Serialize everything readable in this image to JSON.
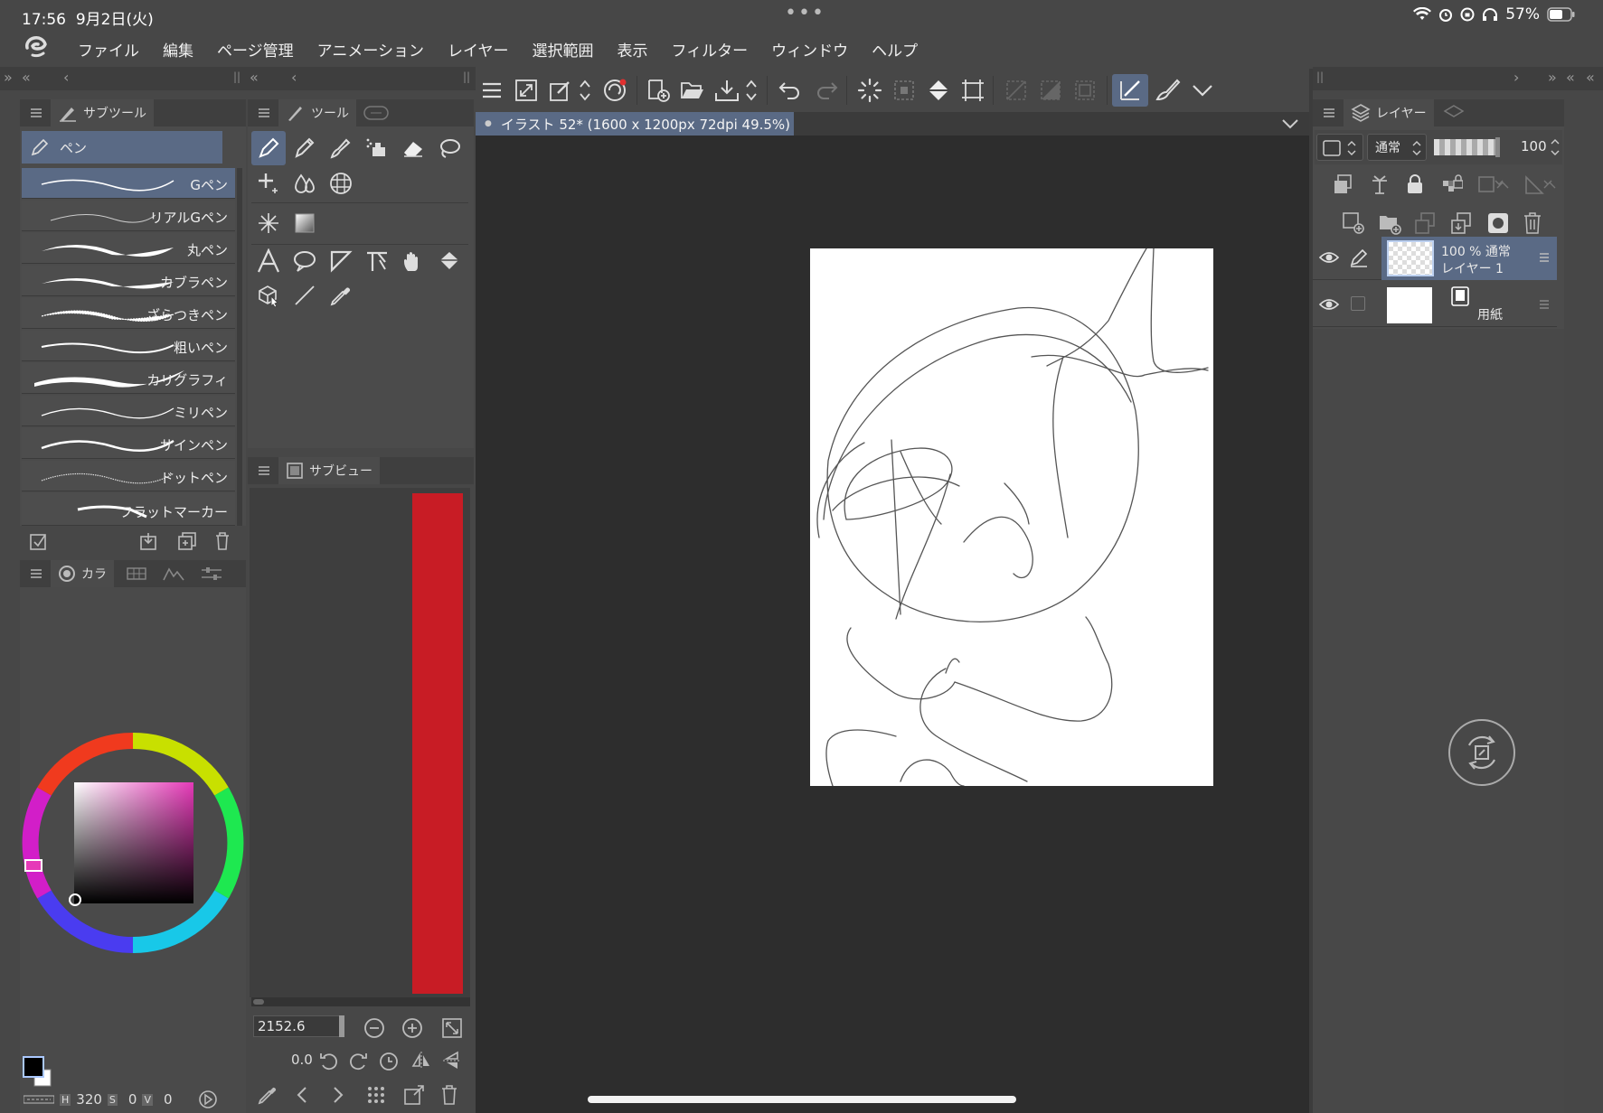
{
  "status_bar": {
    "time": "17:56",
    "date": "9月2日(火)",
    "battery": "57%"
  },
  "menu": {
    "items": [
      "ファイル",
      "編集",
      "ページ管理",
      "アニメーション",
      "レイヤー",
      "選択範囲",
      "表示",
      "フィルター",
      "ウィンドウ",
      "ヘルプ"
    ]
  },
  "subtool_panel": {
    "tab_label": "サブツール",
    "group_label": "ペン",
    "brushes": [
      "Gペン",
      "リアルGペン",
      "丸ペン",
      "カブラペン",
      "ざらつきペン",
      "粗いペン",
      "カリグラフィ",
      "ミリペン",
      "サインペン",
      "ドットペン",
      "フラットマーカー"
    ],
    "selected_index": 0
  },
  "tool_panel": {
    "tab_label": "ツール"
  },
  "color_panel": {
    "tab_label": "カラ",
    "hsv": {
      "h_label": "H",
      "h": "320",
      "s_label": "S",
      "s": "0",
      "v_label": "V",
      "v": "0"
    }
  },
  "subview_panel": {
    "tab_label": "サブビュー",
    "swatch_color": "#c81c25"
  },
  "navigator": {
    "zoom_value": "2152.6",
    "rotation_value": "0.0"
  },
  "document": {
    "tab_title": "イラスト 52* (1600 x 1200px 72dpi 49.5%)"
  },
  "layer_panel": {
    "tab_label": "レイヤー",
    "blend_mode": "通常",
    "opacity": "100",
    "layers": [
      {
        "meta": "100 % 通常",
        "name": "レイヤー 1",
        "selected": true
      },
      {
        "meta": "",
        "name": "用紙",
        "selected": false
      }
    ]
  },
  "colors": {
    "accent_selection": "#5a6a85",
    "panel_bg": "#4b4b4b",
    "canvas_bg": "#2d2d2d",
    "paper": "#ffffff"
  }
}
